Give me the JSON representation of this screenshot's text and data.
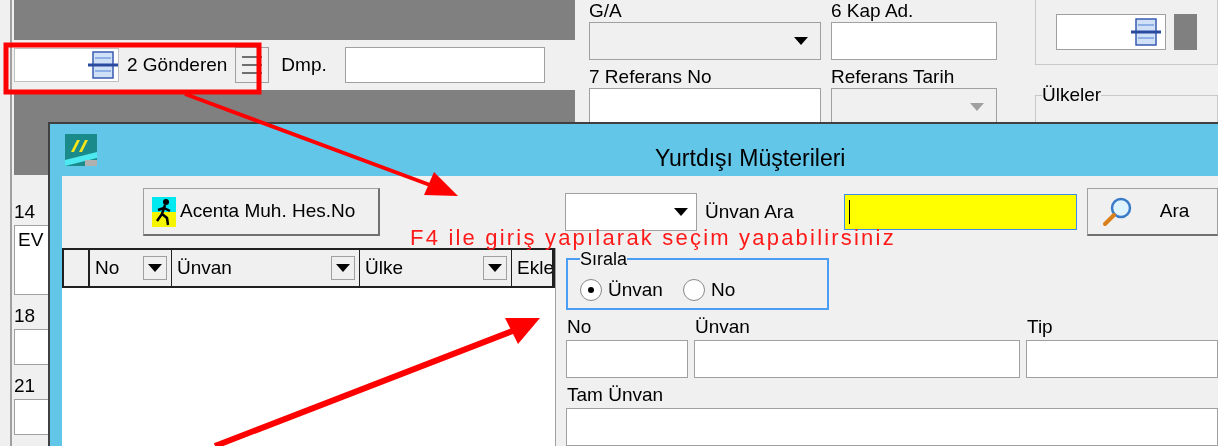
{
  "background_form": {
    "sender": {
      "button": "2 Gönderen",
      "dmp_label": "Dmp."
    },
    "fields": [
      {
        "label": "G/A",
        "kind": "combo",
        "disabled": false
      },
      {
        "label": "6 Kap Ad.",
        "kind": "text",
        "disabled": false
      },
      {
        "label": "7 Referans No",
        "kind": "text",
        "disabled": false
      },
      {
        "label": "Referans Tarih",
        "kind": "combo",
        "disabled": true
      }
    ],
    "left_labels": [
      "14",
      "18",
      "21"
    ],
    "left_field_value": "EV",
    "countries_group": "Ülkeler"
  },
  "dialog": {
    "title": "Yurtdışı Müşterileri",
    "toolbar_button": "Acenta Muh. Hes.No",
    "search_label": "Ünvan Ara",
    "search_field": {
      "focused": true
    },
    "search_button": "Ara",
    "columns": [
      {
        "label": "No",
        "filter": true
      },
      {
        "label": "Ünvan",
        "filter": true
      },
      {
        "label": "Ülke",
        "filter": true
      },
      {
        "label": "Ekle"
      }
    ],
    "sort": {
      "title": "Sırala",
      "options": [
        {
          "label": "Ünvan",
          "selected": true
        },
        {
          "label": "No",
          "selected": false
        }
      ]
    },
    "detail_rows": [
      [
        {
          "label": "No",
          "kind": "code"
        },
        {
          "label": "Ünvan",
          "kind": "name"
        },
        {
          "label": "Tip",
          "kind": "type"
        }
      ],
      [
        {
          "label": "Tam Ünvan",
          "kind": "full"
        }
      ]
    ]
  },
  "annotation": {
    "note": "F4 ile giriş yapılarak seçim yapabilirsiniz"
  }
}
